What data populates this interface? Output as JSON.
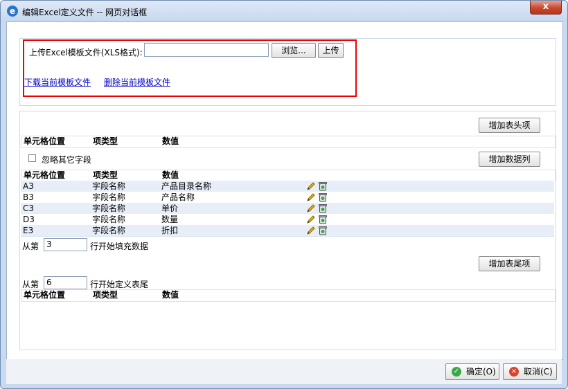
{
  "window": {
    "title": "编辑Excel定义文件 -- 网页对话框",
    "app_icon": "ie-icon",
    "close_label": "x"
  },
  "upload": {
    "label": "上传Excel模板文件(XLS格式):",
    "file_value": "",
    "browse_label": "浏览...",
    "upload_label": "上传",
    "download_link": "下载当前模板文件",
    "delete_link": "删除当前模板文件"
  },
  "columns": [
    "单元格位置",
    "项类型",
    "数值"
  ],
  "header_section": {
    "add_button": "增加表头项"
  },
  "data_section": {
    "ignore_checkbox_label": "忽略其它字段",
    "ignore_checked": false,
    "add_button": "增加数据列",
    "rows": [
      {
        "position": "A3",
        "type": "字段名称",
        "value": "产品目录名称"
      },
      {
        "position": "B3",
        "type": "字段名称",
        "value": "产品名称"
      },
      {
        "position": "C3",
        "type": "字段名称",
        "value": "单价"
      },
      {
        "position": "D3",
        "type": "字段名称",
        "value": "数量"
      },
      {
        "position": "E3",
        "type": "字段名称",
        "value": "折扣"
      }
    ],
    "start_prefix": "从第",
    "start_row": "3",
    "start_suffix": "行开始填充数据"
  },
  "footer_section": {
    "add_button": "增加表尾项",
    "start_prefix": "从第",
    "start_row": "6",
    "start_suffix": "行开始定义表尾"
  },
  "dialog_buttons": {
    "ok": "确定(O)",
    "cancel": "取消(C)"
  },
  "colors": {
    "highlight_border": "#ee0000",
    "link": "#0000cc",
    "alt_row": "#e7eef8"
  }
}
